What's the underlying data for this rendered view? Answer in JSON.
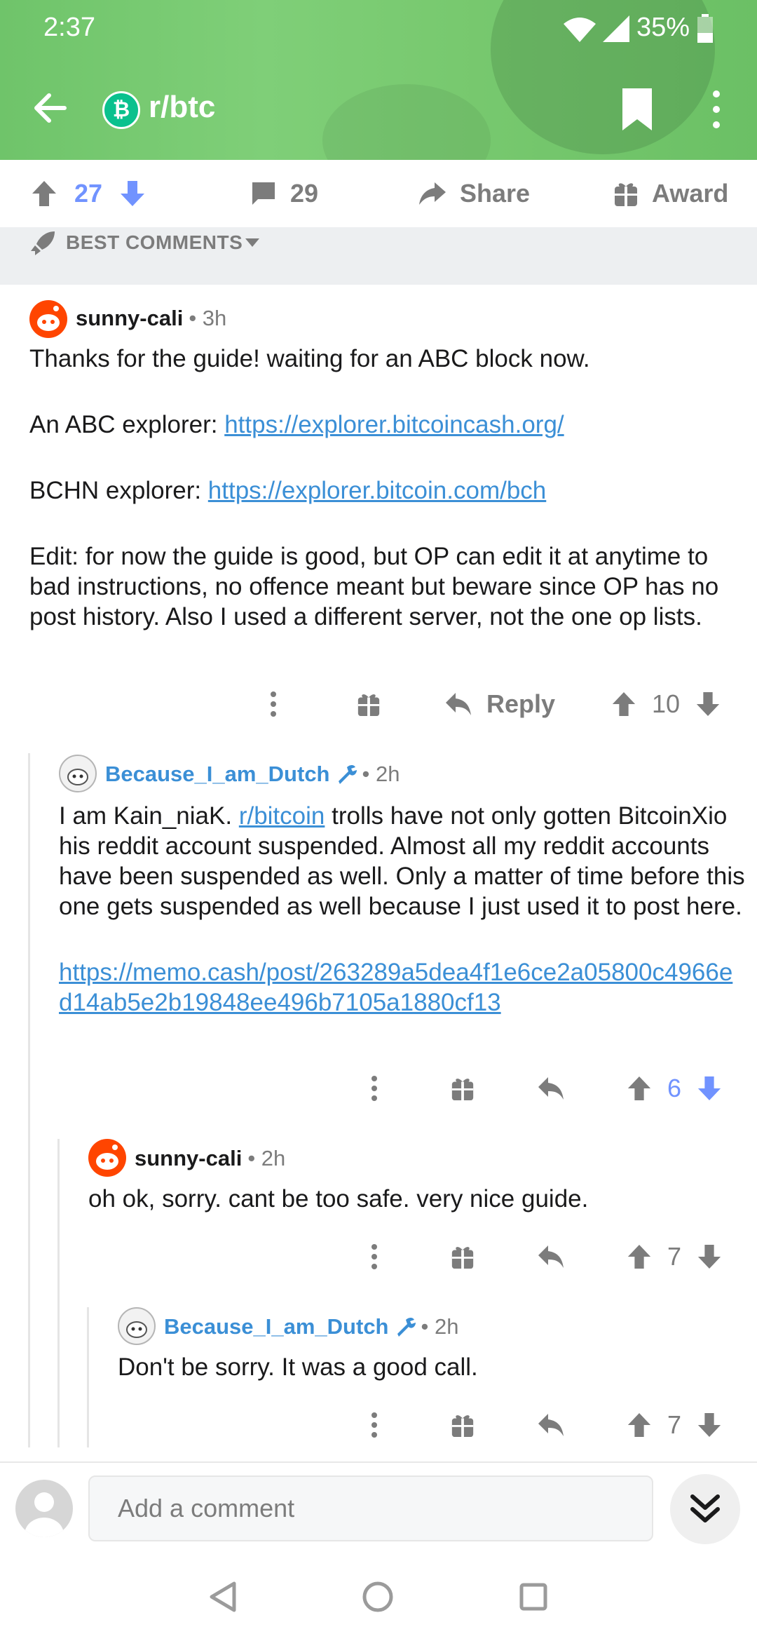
{
  "status_bar": {
    "time": "2:37",
    "battery": "35%"
  },
  "toolbar": {
    "subreddit": "r/btc",
    "avatar_glyph": "₿"
  },
  "post_actions": {
    "votes": "27",
    "comments": "29",
    "share": "Share",
    "award": "Award"
  },
  "sort": {
    "label": "BEST COMMENTS"
  },
  "comments": [
    {
      "author": "sunny-cali",
      "time": "• 3h",
      "body": [
        {
          "text": "Thanks for the guide! waiting for an ABC block now."
        },
        {
          "prefix": "An ABC explorer: ",
          "link": "https://explorer.bitcoincash.org/"
        },
        {
          "prefix": "BCHN explorer: ",
          "link": "https://explorer.bitcoin.com/bch"
        },
        {
          "text": "Edit: for now the guide is good, but OP can edit it at anytime to bad instructions, no offence meant but beware since OP has no post history. Also I used a different server, not the one op lists."
        }
      ],
      "reply_label": "Reply",
      "score": "10"
    },
    {
      "author": "Because_I_am_Dutch",
      "time": "• 2h",
      "body_before": "I am Kain_niaK.  ",
      "body_link": "r/bitcoin",
      "body_after": " trolls have not only gotten BitcoinXio his reddit account suspended. Almost all my reddit accounts have been suspended as well. Only a matter of time before this  one gets suspended as well because I just used it to post here.",
      "url": "https://memo.cash/post/263289a5dea4f1e6ce2a05800c4966ed14ab5e2b19848ee496b7105a1880cf13",
      "score": "6"
    },
    {
      "author": "sunny-cali",
      "time": "• 2h",
      "body": "oh ok, sorry. cant be too safe. very nice guide.",
      "score": "7"
    },
    {
      "author": "Because_I_am_Dutch",
      "time": "• 2h",
      "body": "Don't be sorry. It was a good call.",
      "score": "7"
    }
  ],
  "composer": {
    "placeholder": "Add a comment"
  },
  "colors": {
    "header_green": "#78c96f",
    "upvote_blue": "#7193ff",
    "link_blue": "#3b8fd6"
  }
}
